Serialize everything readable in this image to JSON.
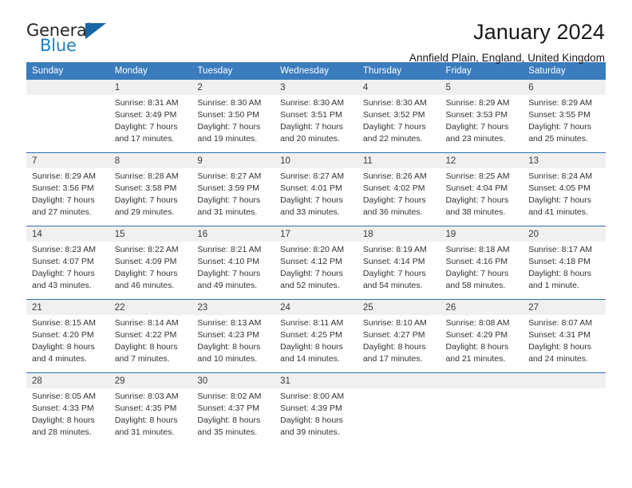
{
  "brand": {
    "name_top": "General",
    "name_bottom": "Blue",
    "triangle_color": "#1566a8",
    "blue_color": "#1f7ec1"
  },
  "header": {
    "title": "January 2024",
    "subtitle": "Annfield Plain, England, United Kingdom"
  },
  "theme": {
    "header_bg": "#3a7cbe",
    "header_text": "#ffffff",
    "daynum_bg": "#f0f0f0",
    "separator": "#2f6fb0"
  },
  "weekdays": [
    "Sunday",
    "Monday",
    "Tuesday",
    "Wednesday",
    "Thursday",
    "Friday",
    "Saturday"
  ],
  "weeks": [
    {
      "days": [
        {
          "num": "",
          "sunrise": "",
          "sunset": "",
          "daylight1": "",
          "daylight2": ""
        },
        {
          "num": "1",
          "sunrise": "Sunrise: 8:31 AM",
          "sunset": "Sunset: 3:49 PM",
          "daylight1": "Daylight: 7 hours",
          "daylight2": "and 17 minutes."
        },
        {
          "num": "2",
          "sunrise": "Sunrise: 8:30 AM",
          "sunset": "Sunset: 3:50 PM",
          "daylight1": "Daylight: 7 hours",
          "daylight2": "and 19 minutes."
        },
        {
          "num": "3",
          "sunrise": "Sunrise: 8:30 AM",
          "sunset": "Sunset: 3:51 PM",
          "daylight1": "Daylight: 7 hours",
          "daylight2": "and 20 minutes."
        },
        {
          "num": "4",
          "sunrise": "Sunrise: 8:30 AM",
          "sunset": "Sunset: 3:52 PM",
          "daylight1": "Daylight: 7 hours",
          "daylight2": "and 22 minutes."
        },
        {
          "num": "5",
          "sunrise": "Sunrise: 8:29 AM",
          "sunset": "Sunset: 3:53 PM",
          "daylight1": "Daylight: 7 hours",
          "daylight2": "and 23 minutes."
        },
        {
          "num": "6",
          "sunrise": "Sunrise: 8:29 AM",
          "sunset": "Sunset: 3:55 PM",
          "daylight1": "Daylight: 7 hours",
          "daylight2": "and 25 minutes."
        }
      ]
    },
    {
      "days": [
        {
          "num": "7",
          "sunrise": "Sunrise: 8:29 AM",
          "sunset": "Sunset: 3:56 PM",
          "daylight1": "Daylight: 7 hours",
          "daylight2": "and 27 minutes."
        },
        {
          "num": "8",
          "sunrise": "Sunrise: 8:28 AM",
          "sunset": "Sunset: 3:58 PM",
          "daylight1": "Daylight: 7 hours",
          "daylight2": "and 29 minutes."
        },
        {
          "num": "9",
          "sunrise": "Sunrise: 8:27 AM",
          "sunset": "Sunset: 3:59 PM",
          "daylight1": "Daylight: 7 hours",
          "daylight2": "and 31 minutes."
        },
        {
          "num": "10",
          "sunrise": "Sunrise: 8:27 AM",
          "sunset": "Sunset: 4:01 PM",
          "daylight1": "Daylight: 7 hours",
          "daylight2": "and 33 minutes."
        },
        {
          "num": "11",
          "sunrise": "Sunrise: 8:26 AM",
          "sunset": "Sunset: 4:02 PM",
          "daylight1": "Daylight: 7 hours",
          "daylight2": "and 36 minutes."
        },
        {
          "num": "12",
          "sunrise": "Sunrise: 8:25 AM",
          "sunset": "Sunset: 4:04 PM",
          "daylight1": "Daylight: 7 hours",
          "daylight2": "and 38 minutes."
        },
        {
          "num": "13",
          "sunrise": "Sunrise: 8:24 AM",
          "sunset": "Sunset: 4:05 PM",
          "daylight1": "Daylight: 7 hours",
          "daylight2": "and 41 minutes."
        }
      ]
    },
    {
      "days": [
        {
          "num": "14",
          "sunrise": "Sunrise: 8:23 AM",
          "sunset": "Sunset: 4:07 PM",
          "daylight1": "Daylight: 7 hours",
          "daylight2": "and 43 minutes."
        },
        {
          "num": "15",
          "sunrise": "Sunrise: 8:22 AM",
          "sunset": "Sunset: 4:09 PM",
          "daylight1": "Daylight: 7 hours",
          "daylight2": "and 46 minutes."
        },
        {
          "num": "16",
          "sunrise": "Sunrise: 8:21 AM",
          "sunset": "Sunset: 4:10 PM",
          "daylight1": "Daylight: 7 hours",
          "daylight2": "and 49 minutes."
        },
        {
          "num": "17",
          "sunrise": "Sunrise: 8:20 AM",
          "sunset": "Sunset: 4:12 PM",
          "daylight1": "Daylight: 7 hours",
          "daylight2": "and 52 minutes."
        },
        {
          "num": "18",
          "sunrise": "Sunrise: 8:19 AM",
          "sunset": "Sunset: 4:14 PM",
          "daylight1": "Daylight: 7 hours",
          "daylight2": "and 54 minutes."
        },
        {
          "num": "19",
          "sunrise": "Sunrise: 8:18 AM",
          "sunset": "Sunset: 4:16 PM",
          "daylight1": "Daylight: 7 hours",
          "daylight2": "and 58 minutes."
        },
        {
          "num": "20",
          "sunrise": "Sunrise: 8:17 AM",
          "sunset": "Sunset: 4:18 PM",
          "daylight1": "Daylight: 8 hours",
          "daylight2": "and 1 minute."
        }
      ]
    },
    {
      "days": [
        {
          "num": "21",
          "sunrise": "Sunrise: 8:15 AM",
          "sunset": "Sunset: 4:20 PM",
          "daylight1": "Daylight: 8 hours",
          "daylight2": "and 4 minutes."
        },
        {
          "num": "22",
          "sunrise": "Sunrise: 8:14 AM",
          "sunset": "Sunset: 4:22 PM",
          "daylight1": "Daylight: 8 hours",
          "daylight2": "and 7 minutes."
        },
        {
          "num": "23",
          "sunrise": "Sunrise: 8:13 AM",
          "sunset": "Sunset: 4:23 PM",
          "daylight1": "Daylight: 8 hours",
          "daylight2": "and 10 minutes."
        },
        {
          "num": "24",
          "sunrise": "Sunrise: 8:11 AM",
          "sunset": "Sunset: 4:25 PM",
          "daylight1": "Daylight: 8 hours",
          "daylight2": "and 14 minutes."
        },
        {
          "num": "25",
          "sunrise": "Sunrise: 8:10 AM",
          "sunset": "Sunset: 4:27 PM",
          "daylight1": "Daylight: 8 hours",
          "daylight2": "and 17 minutes."
        },
        {
          "num": "26",
          "sunrise": "Sunrise: 8:08 AM",
          "sunset": "Sunset: 4:29 PM",
          "daylight1": "Daylight: 8 hours",
          "daylight2": "and 21 minutes."
        },
        {
          "num": "27",
          "sunrise": "Sunrise: 8:07 AM",
          "sunset": "Sunset: 4:31 PM",
          "daylight1": "Daylight: 8 hours",
          "daylight2": "and 24 minutes."
        }
      ]
    },
    {
      "days": [
        {
          "num": "28",
          "sunrise": "Sunrise: 8:05 AM",
          "sunset": "Sunset: 4:33 PM",
          "daylight1": "Daylight: 8 hours",
          "daylight2": "and 28 minutes."
        },
        {
          "num": "29",
          "sunrise": "Sunrise: 8:03 AM",
          "sunset": "Sunset: 4:35 PM",
          "daylight1": "Daylight: 8 hours",
          "daylight2": "and 31 minutes."
        },
        {
          "num": "30",
          "sunrise": "Sunrise: 8:02 AM",
          "sunset": "Sunset: 4:37 PM",
          "daylight1": "Daylight: 8 hours",
          "daylight2": "and 35 minutes."
        },
        {
          "num": "31",
          "sunrise": "Sunrise: 8:00 AM",
          "sunset": "Sunset: 4:39 PM",
          "daylight1": "Daylight: 8 hours",
          "daylight2": "and 39 minutes."
        },
        {
          "num": "",
          "sunrise": "",
          "sunset": "",
          "daylight1": "",
          "daylight2": ""
        },
        {
          "num": "",
          "sunrise": "",
          "sunset": "",
          "daylight1": "",
          "daylight2": ""
        },
        {
          "num": "",
          "sunrise": "",
          "sunset": "",
          "daylight1": "",
          "daylight2": ""
        }
      ]
    }
  ]
}
